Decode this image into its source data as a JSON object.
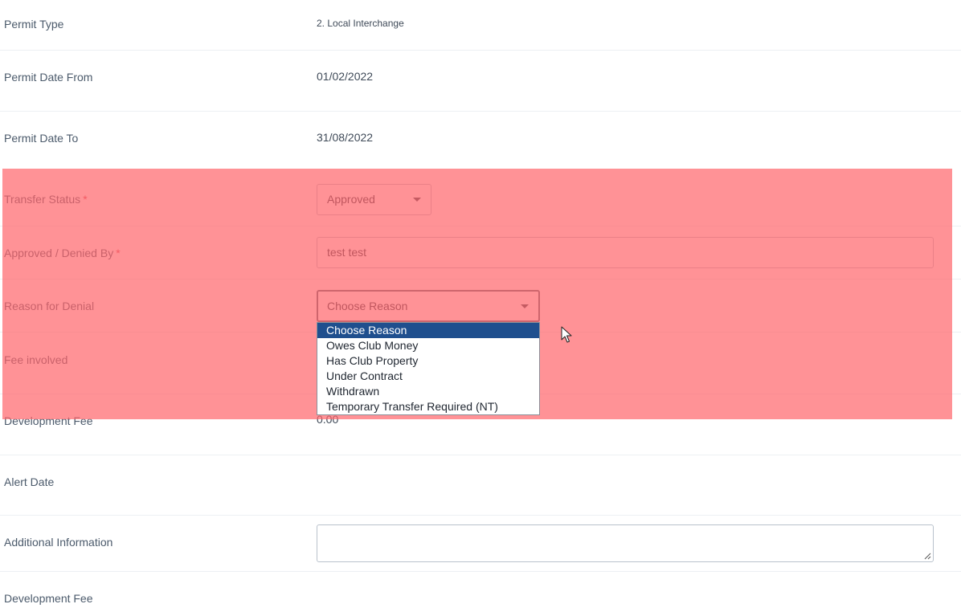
{
  "fields": {
    "permit_type": {
      "label": "Permit Type",
      "value": "2. Local Interchange"
    },
    "permit_date_from": {
      "label": "Permit Date From",
      "value": "01/02/2022"
    },
    "permit_date_to": {
      "label": "Permit Date To",
      "value": "31/08/2022"
    },
    "transfer_status": {
      "label": "Transfer Status",
      "required_mark": "*",
      "value": "Approved"
    },
    "approved_by": {
      "label": "Approved / Denied By",
      "required_mark": "*",
      "value": "test test"
    },
    "reason_for_denial": {
      "label": "Reason for Denial",
      "value": "Choose Reason",
      "options": [
        "Choose Reason",
        "Owes Club Money",
        "Has Club Property",
        "Under Contract",
        "Withdrawn",
        "Temporary Transfer Required (NT)"
      ],
      "selected_index": 0
    },
    "fee_involved": {
      "label": "Fee involved"
    },
    "development_fee": {
      "label": "Development Fee",
      "value": "0.00"
    },
    "alert_date": {
      "label": "Alert Date"
    },
    "additional_information": {
      "label": "Additional Information",
      "value": ""
    },
    "development_fee_2": {
      "label": "Development Fee"
    }
  },
  "colors": {
    "highlight": "#ff646a",
    "selected_option": "#1f4f8e",
    "required": "#d94a57"
  },
  "icons": [
    "caret-down-icon",
    "mouse-cursor-icon",
    "resize-grip-icon"
  ]
}
